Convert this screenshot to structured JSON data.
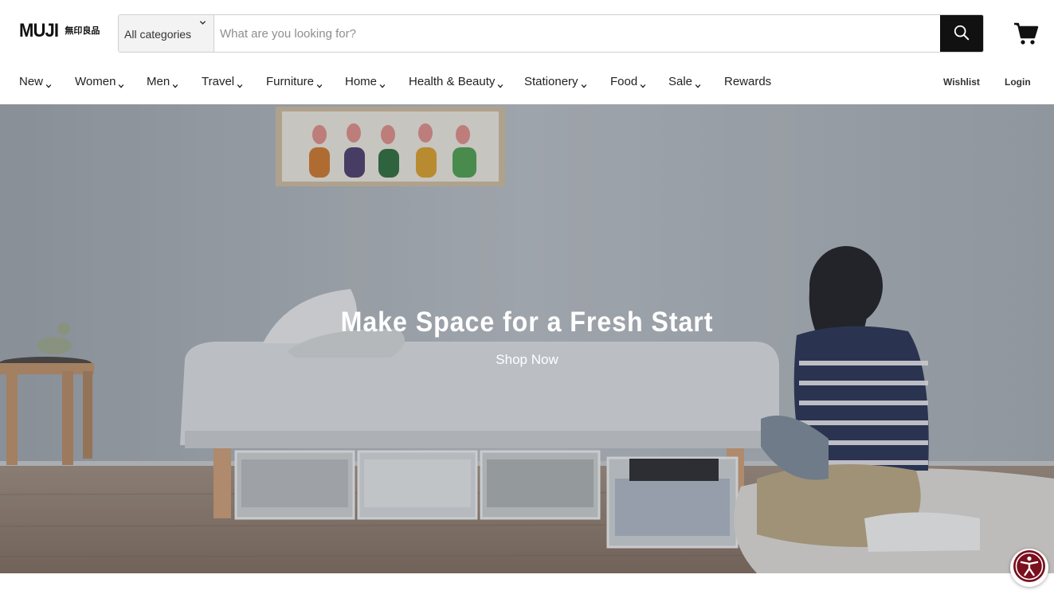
{
  "brand": {
    "name_latin": "MUJI",
    "name_jp": "無印良品"
  },
  "search": {
    "category_selected": "All categories",
    "placeholder": "What are you looking for?",
    "value": ""
  },
  "icons": {
    "search": "search-icon",
    "cart": "cart-icon",
    "dropdown": "chevron-down-icon",
    "accessibility": "accessibility-icon"
  },
  "nav": {
    "items": [
      {
        "label": "New",
        "has_dropdown": true
      },
      {
        "label": "Women",
        "has_dropdown": true
      },
      {
        "label": "Men",
        "has_dropdown": true
      },
      {
        "label": "Travel",
        "has_dropdown": true
      },
      {
        "label": "Furniture",
        "has_dropdown": true
      },
      {
        "label": "Home",
        "has_dropdown": true
      },
      {
        "label": "Health & Beauty",
        "has_dropdown": true
      },
      {
        "label": "Stationery",
        "has_dropdown": true
      },
      {
        "label": "Food",
        "has_dropdown": true
      },
      {
        "label": "Sale",
        "has_dropdown": true
      },
      {
        "label": "Rewards",
        "has_dropdown": false
      }
    ],
    "wishlist": "Wishlist",
    "login": "Login"
  },
  "hero": {
    "title": "Make Space for a Fresh Start",
    "cta": "Shop Now"
  },
  "colors": {
    "accent_dark": "#111111",
    "accessibility_badge": "#7a0f1e",
    "hero_text": "#ffffff"
  }
}
